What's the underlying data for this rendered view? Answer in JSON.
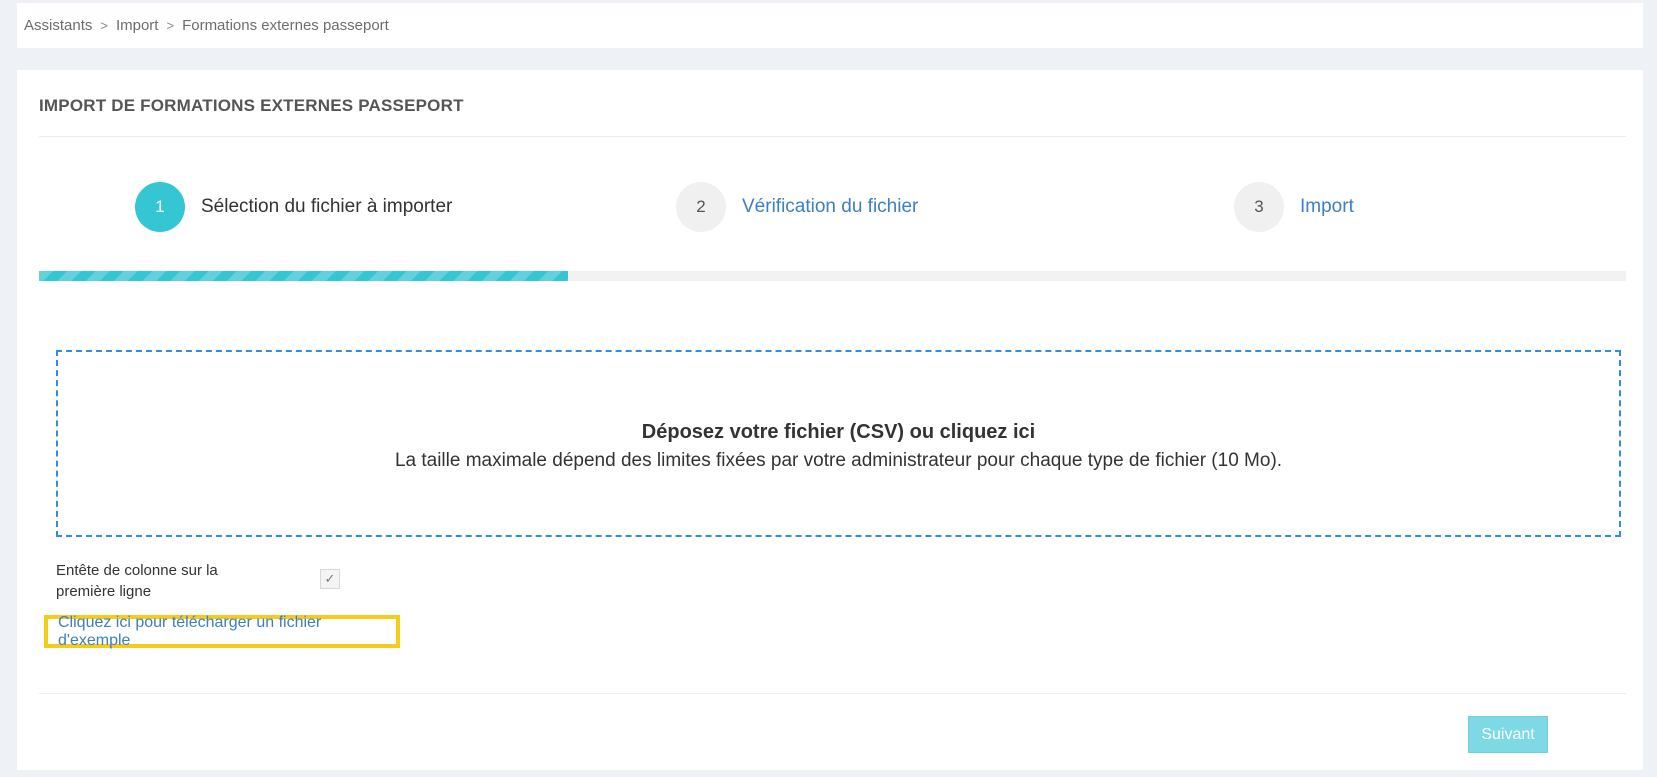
{
  "breadcrumb": {
    "items": [
      "Assistants",
      "Import",
      "Formations externes passeport"
    ],
    "separator": ">"
  },
  "page": {
    "title": "IMPORT DE FORMATIONS EXTERNES PASSEPORT"
  },
  "steps": [
    {
      "number": "1",
      "label": "Sélection du fichier à importer",
      "active": true
    },
    {
      "number": "2",
      "label": "Vérification du fichier",
      "active": false
    },
    {
      "number": "3",
      "label": "Import",
      "active": false
    }
  ],
  "progress": {
    "fraction": 0.3333
  },
  "dropzone": {
    "title": "Déposez votre fichier (CSV) ou cliquez ici",
    "subtitle": "La taille maximale dépend des limites fixées par votre administrateur pour chaque type de fichier (10 Mo)."
  },
  "options": {
    "header_row_label": "Entête de colonne sur la première ligne",
    "header_row_checked": true,
    "check_glyph": "✓"
  },
  "example_link": {
    "label": "Cliquez ici pour télécharger un fichier d'exemple"
  },
  "actions": {
    "next_label": "Suivant"
  },
  "colors": {
    "accent": "#35c6d4",
    "link": "#3c7fc2",
    "dropzone_border": "#2f8de4",
    "highlight": "#f6cc1b",
    "next_button": "#7dd9e4"
  }
}
